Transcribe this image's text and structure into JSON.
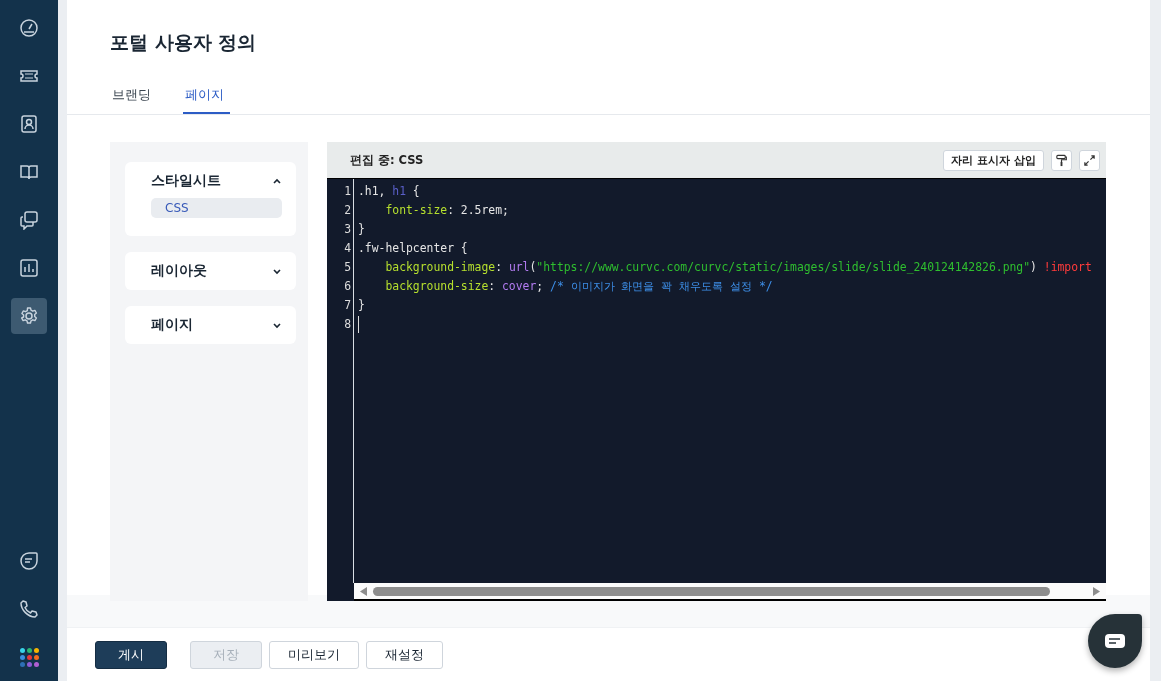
{
  "nav": {
    "items": [
      {
        "selected": false
      },
      {
        "selected": false
      },
      {
        "selected": false
      },
      {
        "selected": false
      },
      {
        "selected": false
      },
      {
        "selected": false
      },
      {
        "selected": true
      }
    ],
    "bottom_items": [
      {
        "selected": false
      },
      {
        "selected": false
      },
      {
        "selected": false
      }
    ]
  },
  "page": {
    "title": "포털 사용자 정의"
  },
  "tabs": [
    {
      "label": "브랜딩",
      "selected": false
    },
    {
      "label": "페이지",
      "selected": true
    }
  ],
  "sections": [
    {
      "title": "스타일시트",
      "expanded": true,
      "items": [
        {
          "label": "CSS",
          "selected": true
        }
      ]
    },
    {
      "title": "레이아웃",
      "expanded": false
    },
    {
      "title": "페이지",
      "expanded": false
    }
  ],
  "editor": {
    "heading": "편집 중: CSS",
    "insert_button": "자리 표시자 삽입",
    "lines": [
      {
        "number": "1",
        "cursor": false,
        "indent": false,
        "tokens": [
          {
            "kind": "plain",
            "text": ".h1, "
          },
          {
            "kind": "tag",
            "text": "h1"
          },
          {
            "kind": "plain",
            "text": " {"
          }
        ]
      },
      {
        "number": "2",
        "cursor": false,
        "indent": true,
        "tokens": [
          {
            "kind": "property",
            "text": "font-size"
          },
          {
            "kind": "plain",
            "text": ": 2.5rem;"
          }
        ]
      },
      {
        "number": "3",
        "cursor": false,
        "indent": false,
        "tokens": [
          {
            "kind": "plain",
            "text": "}"
          }
        ]
      },
      {
        "number": "4",
        "cursor": false,
        "indent": false,
        "tokens": [
          {
            "kind": "plain",
            "text": ".fw-helpcenter {"
          }
        ]
      },
      {
        "number": "5",
        "cursor": false,
        "indent": true,
        "tokens": [
          {
            "kind": "property",
            "text": "background-image"
          },
          {
            "kind": "plain",
            "text": ": "
          },
          {
            "kind": "keyword",
            "text": "url"
          },
          {
            "kind": "plain",
            "text": "("
          },
          {
            "kind": "string",
            "text": "\"https://www.curvc.com/curvc/static/images/slide/slide_240124142826.png\""
          },
          {
            "kind": "plain",
            "text": ") "
          },
          {
            "kind": "important",
            "text": "!import"
          }
        ]
      },
      {
        "number": "6",
        "cursor": false,
        "indent": true,
        "tokens": [
          {
            "kind": "property",
            "text": "background-size"
          },
          {
            "kind": "plain",
            "text": ": "
          },
          {
            "kind": "keyword",
            "text": "cover"
          },
          {
            "kind": "plain",
            "text": "; "
          },
          {
            "kind": "comment",
            "text": "/* 이미지가 화면을 꽉 채우도록 설정 */"
          }
        ]
      },
      {
        "number": "7",
        "cursor": false,
        "indent": false,
        "tokens": [
          {
            "kind": "plain",
            "text": "}"
          }
        ]
      },
      {
        "number": "8",
        "cursor": true,
        "indent": false
      }
    ]
  },
  "footer": {
    "buttons": [
      {
        "label": "게시",
        "kind": "primary",
        "disabled": false
      },
      {
        "label": "저장",
        "kind": "secondary",
        "disabled": true
      },
      {
        "label": "미리보기",
        "kind": "secondary",
        "disabled": false
      },
      {
        "label": "재설정",
        "kind": "secondary",
        "disabled": false
      }
    ]
  }
}
